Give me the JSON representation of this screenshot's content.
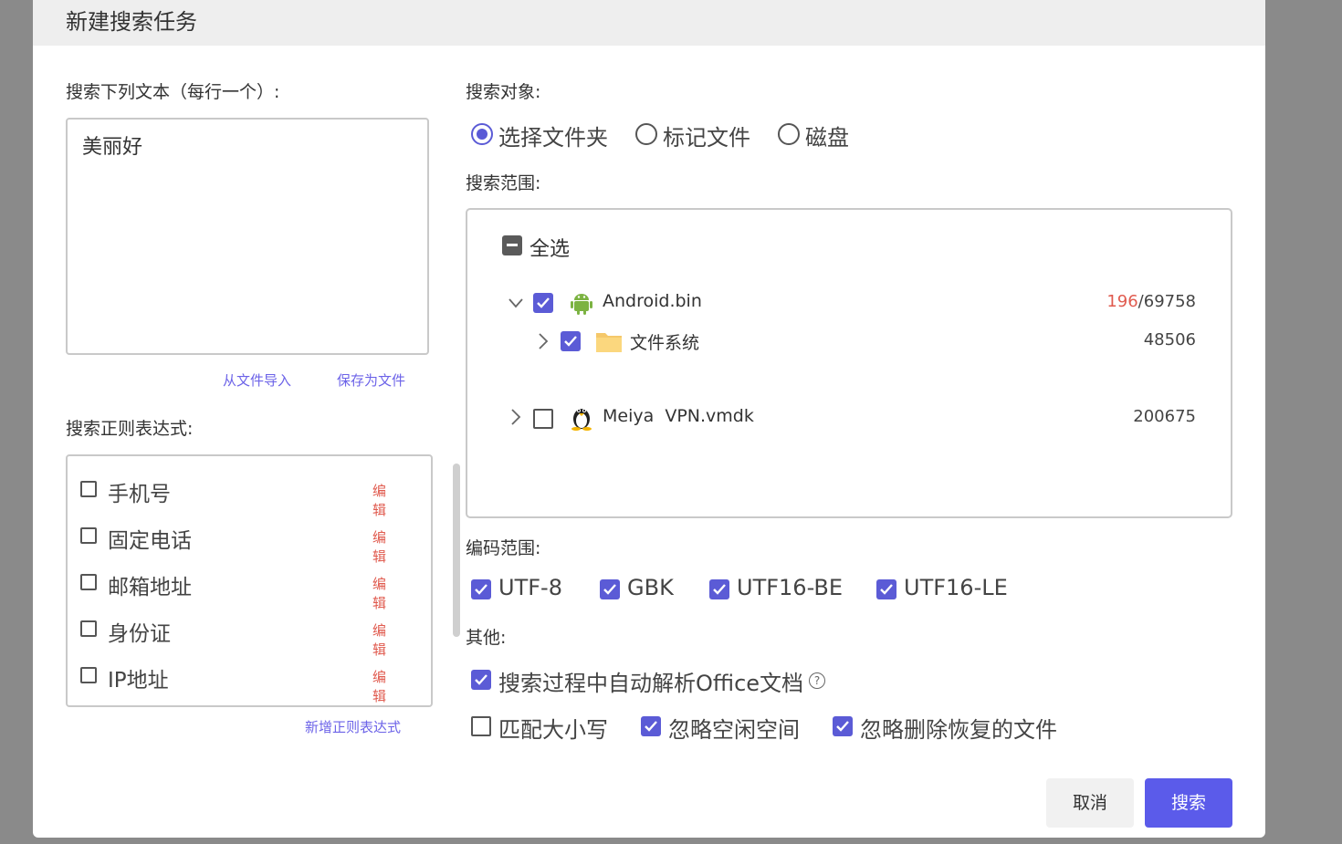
{
  "dialog": {
    "title": "新建搜索任务",
    "cancel_label": "取消",
    "search_label": "搜索"
  },
  "text_search": {
    "label": "搜索下列文本（每行一个）:",
    "value": "美丽好",
    "import_link": "从文件导入",
    "save_link": "保存为文件"
  },
  "regex": {
    "label": "搜索正则表达式:",
    "items": [
      {
        "label": "手机号",
        "checked": false,
        "edit": "编辑"
      },
      {
        "label": "固定电话",
        "checked": false,
        "edit": "编辑"
      },
      {
        "label": "邮箱地址",
        "checked": false,
        "edit": "编辑"
      },
      {
        "label": "身份证",
        "checked": false,
        "edit": "编辑"
      },
      {
        "label": "IP地址",
        "checked": false,
        "edit": "编辑"
      }
    ],
    "add_link": "新增正则表达式"
  },
  "target": {
    "label": "搜索对象:",
    "options": [
      {
        "label": "选择文件夹",
        "selected": true
      },
      {
        "label": "标记文件",
        "selected": false
      },
      {
        "label": "磁盘",
        "selected": false
      }
    ]
  },
  "scope": {
    "label": "搜索范围:",
    "select_all": "全选",
    "items": [
      {
        "name": "Android.bin",
        "checked": true,
        "expanded": true,
        "icon": "android-icon",
        "count_hit": "196",
        "count_total": "/69758"
      },
      {
        "name": "文件系统",
        "checked": true,
        "expanded": false,
        "icon": "folder-icon",
        "count": "48506"
      },
      {
        "name": "Meiya  VPN.vmdk",
        "checked": false,
        "expanded": false,
        "icon": "linux-penguin-icon",
        "count": "200675"
      }
    ]
  },
  "encoding": {
    "label": "编码范围:",
    "options": [
      {
        "label": "UTF-8",
        "checked": true
      },
      {
        "label": "GBK",
        "checked": true
      },
      {
        "label": "UTF16-BE",
        "checked": true
      },
      {
        "label": "UTF16-LE",
        "checked": true
      }
    ]
  },
  "other": {
    "label": "其他:",
    "parse_office": {
      "label": "搜索过程中自动解析Office文档",
      "checked": true
    },
    "match_case": {
      "label": "匹配大小写",
      "checked": false
    },
    "ignore_free": {
      "label": "忽略空闲空间",
      "checked": true
    },
    "ignore_deleted": {
      "label": "忽略删除恢复的文件",
      "checked": true
    }
  },
  "colors": {
    "accent": "#5b5bea",
    "edit_red": "#e05a4e",
    "header_bg": "#eeeeee"
  }
}
